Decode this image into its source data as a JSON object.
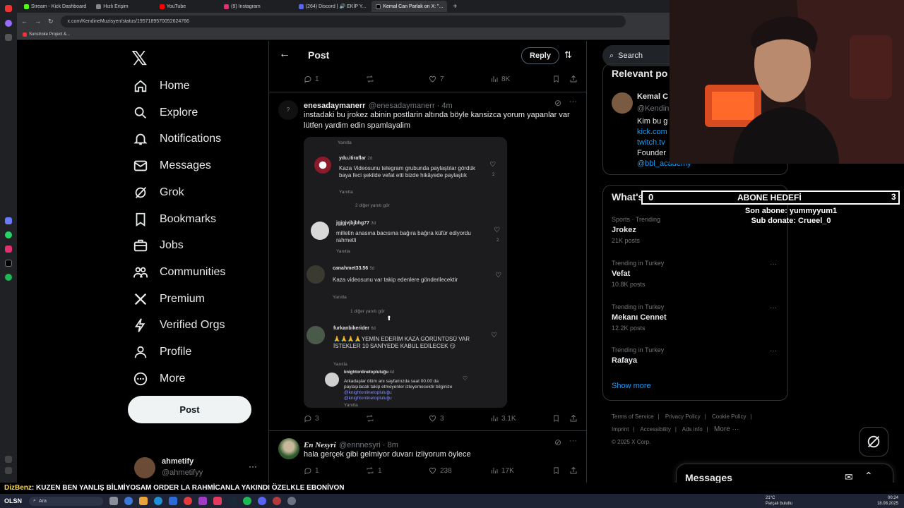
{
  "browser": {
    "tabs": [
      {
        "label": "Stream - Kick Dashboard",
        "color": "#53fc18"
      },
      {
        "label": "Hızlı Erişim",
        "color": "#888888"
      },
      {
        "label": "YouTube",
        "color": "#ff0000"
      },
      {
        "label": "(9) Instagram",
        "color": "#e1306c"
      },
      {
        "label": "(264) Discord | 🔊 EKİP Y...",
        "color": "#5865f2"
      },
      {
        "label": "Kemal Can Parlak on X: \"...",
        "color": "#ffffff"
      }
    ],
    "url": "x.com/KendineMuzisyen/status/1957189570052624766",
    "bookmark": "Sunstroke Project &..."
  },
  "nav": {
    "items": [
      {
        "label": "Home",
        "icon": "home-icon"
      },
      {
        "label": "Explore",
        "icon": "search-icon"
      },
      {
        "label": "Notifications",
        "icon": "bell-icon"
      },
      {
        "label": "Messages",
        "icon": "mail-icon"
      },
      {
        "label": "Grok",
        "icon": "grok-icon"
      },
      {
        "label": "Bookmarks",
        "icon": "bookmark-icon"
      },
      {
        "label": "Jobs",
        "icon": "briefcase-icon"
      },
      {
        "label": "Communities",
        "icon": "people-icon"
      },
      {
        "label": "Premium",
        "icon": "x-icon"
      },
      {
        "label": "Verified Orgs",
        "icon": "lightning-icon"
      },
      {
        "label": "Profile",
        "icon": "person-icon"
      },
      {
        "label": "More",
        "icon": "more-circle-icon"
      }
    ],
    "post_label": "Post",
    "account": {
      "name": "ahmetify",
      "handle": "@ahmetifyy"
    }
  },
  "header": {
    "title": "Post",
    "reply_label": "Reply"
  },
  "top_actions": {
    "replies": "1",
    "reposts": "",
    "likes": "7",
    "views": "8K"
  },
  "tweet1": {
    "name": "enesadaymanerr",
    "handle": "@enesadaymanerr · 4m",
    "text": "instadaki bu jrokez abinin postlarin altında böyle kansizca yorum yapanlar var lütfen yardim edin spamlayalim",
    "actions": {
      "replies": "3",
      "reposts": "",
      "likes": "3",
      "views": "3.1K"
    }
  },
  "embedded": {
    "reply_top": "Yanıtla",
    "comments": [
      {
        "user": "ydu.itiraflar",
        "time": "2d",
        "text": "Kaza Videosunu telegram grubunda paylaştılar gördük baya feci şekilde vefat etti bizde hikâyede paylaştık",
        "reply": "Yanıtla",
        "likes": "2"
      },
      {
        "more": "2 diğer yanıtı gör"
      },
      {
        "user": "jgjgjvjbjbhg77",
        "time": "3d",
        "text": "milletin anasına bacısına bağıra bağıra küfür ediyordu rahmetli",
        "reply": "Yanıtla",
        "likes": "2"
      },
      {
        "user": "canahmet33.56",
        "time": "5d",
        "text": "Kaza videosunu var takip edenlere gönderilecektir",
        "reply": "Yanıtla",
        "likes": ""
      },
      {
        "more": "1 diğer yanıtı gör"
      },
      {
        "user": "furkanbikerider",
        "time": "6d",
        "text": "🙏🙏🙏🙏YEMİN EDERİM KAZA GÖRÜNTÜSÜ VAR İSTEKLER 10 SANİYEDE KABUL EDİLECEK 😏",
        "reply": "Yanıtla",
        "likes": ""
      },
      {
        "user": "knightonlinetopluluğu",
        "time": "4d",
        "text": "Arkadaşlar ölüm anı sayfamızda saat 00.00 da paylaşılacak takip etmeyenler izleyemecektir bilginize",
        "links": [
          "@knightonlinetopluluğu",
          "@knightonlinetopluluğu"
        ],
        "reply": "Yanıtla",
        "likes": ""
      }
    ]
  },
  "tweet2": {
    "name": "En Nesyri",
    "handle": "@ennnesyri · 8m",
    "text": "hala gerçek gibi gelmiyor duvarı izliyorum öylece",
    "actions": {
      "replies": "1",
      "reposts": "1",
      "likes": "238",
      "views": "17K"
    }
  },
  "right": {
    "search_placeholder": "Search",
    "relevant": {
      "title": "Relevant po",
      "name": "Kemal C",
      "handle": "@Kendin",
      "bio": "Kim bu g",
      "links": [
        "kick.com",
        "twitch.tv",
        "@bbl_academy"
      ],
      "founder": "Founder"
    },
    "happening_title": "What's happening",
    "trends": [
      {
        "cat": "Sports · Trending",
        "name": "Jrokez",
        "count": "21K posts"
      },
      {
        "cat": "Trending in Turkey",
        "name": "Vefat",
        "count": "10.8K posts"
      },
      {
        "cat": "Trending in Turkey",
        "name": "Mekanı Cennet",
        "count": "12.2K posts"
      },
      {
        "cat": "Trending in Turkey",
        "name": "Rafaya",
        "count": ""
      }
    ],
    "show_more": "Show more",
    "footer": [
      "Terms of Service",
      "Privacy Policy",
      "Cookie Policy",
      "Imprint",
      "Accessibility",
      "Ads info",
      "More ···",
      "© 2025 X Corp."
    ],
    "messages_label": "Messages"
  },
  "overlay": {
    "left": "0",
    "title": "ABONE HEDEFİ",
    "right": "3",
    "last_sub": "Son abone: yummyyum1",
    "sub_donate": "Sub donate: Crueel_0"
  },
  "ticker": {
    "name": "DizBenz",
    "text": ": KUZEN BEN YANLIŞ BİLMİYOSAM ORDER LA RAHMİCANLA YAKINDI ÖZELKLE EBONİVON"
  },
  "taskbar": {
    "osn": "OLSN",
    "search": "Ara",
    "weather_temp": "21°C",
    "weather_text": "Parçalı bulutlu",
    "time": "00:24",
    "date": "18.08.2025"
  }
}
